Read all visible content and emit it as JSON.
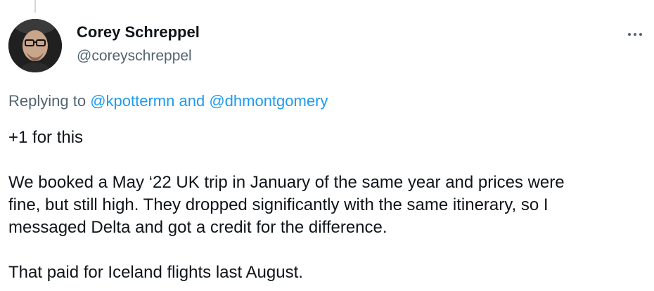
{
  "author": {
    "name": "Corey Schreppel",
    "handle": "@coreyschreppel",
    "avatar_icon": "profile-photo"
  },
  "more_icon": "more-options-icon",
  "reply_context": {
    "prefix": "Replying to",
    "mention_1": "@kpottermn",
    "joiner": "and",
    "mention_2": "@dhmontgomery"
  },
  "tweet": {
    "line_1": "+1 for this",
    "line_2": "We booked a May ‘22 UK trip in January of the same year and prices were",
    "line_3": "fine, but still high. They dropped significantly with the same itinerary, so I",
    "line_4": "messaged Delta and got a credit for the difference.",
    "line_5": "That paid for Iceland flights last August."
  },
  "colors": {
    "text": "#0f1419",
    "secondary": "#536471",
    "link": "#1d9bf0"
  }
}
